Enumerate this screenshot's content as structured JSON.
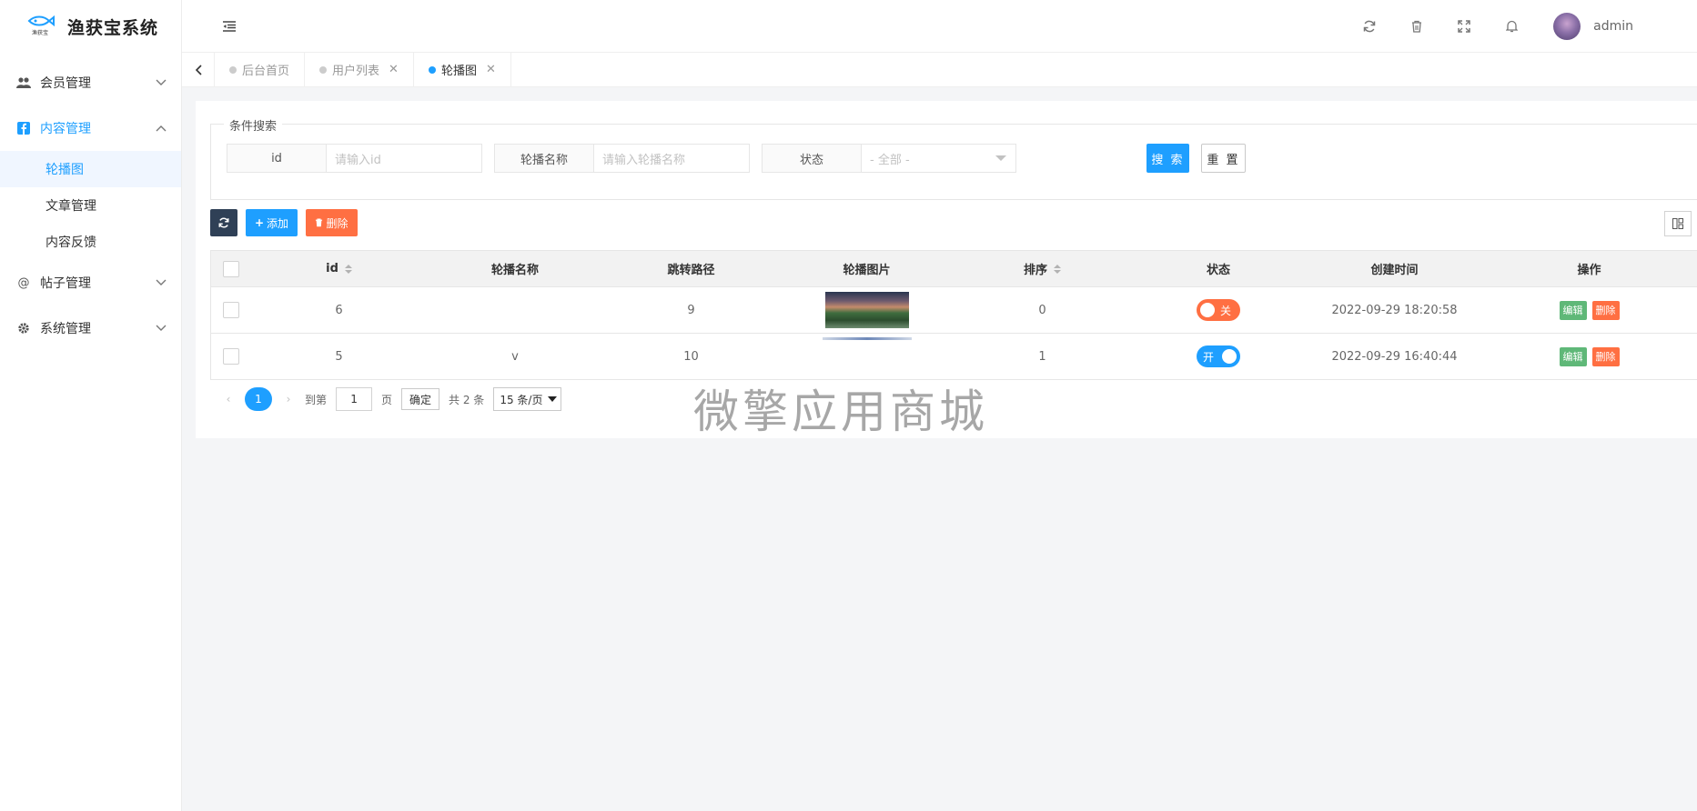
{
  "app": {
    "title": "渔获宝系统",
    "logo_text": "渔获宝"
  },
  "sidebar": {
    "items": [
      {
        "label": "会员管理",
        "icon": "users-icon",
        "expanded": false
      },
      {
        "label": "内容管理",
        "icon": "facebook-square-icon",
        "expanded": true,
        "children": [
          {
            "label": "轮播图",
            "active": true
          },
          {
            "label": "文章管理"
          },
          {
            "label": "内容反馈"
          }
        ]
      },
      {
        "label": "帖子管理",
        "icon": "at-icon",
        "expanded": false
      },
      {
        "label": "系统管理",
        "icon": "gear-icon",
        "expanded": false
      }
    ]
  },
  "header": {
    "icons": [
      "refresh-icon",
      "trash-icon",
      "fullscreen-icon",
      "bell-icon"
    ],
    "user_name": "admin"
  },
  "tabs": [
    {
      "label": "后台首页",
      "active": false,
      "closable": false
    },
    {
      "label": "用户列表",
      "active": false,
      "closable": true
    },
    {
      "label": "轮播图",
      "active": true,
      "closable": true
    }
  ],
  "search": {
    "legend": "条件搜索",
    "fields": [
      {
        "label": "id",
        "placeholder": "请输入id"
      },
      {
        "label": "轮播名称",
        "placeholder": "请输入轮播名称"
      },
      {
        "label": "状态",
        "selected": "- 全部 -"
      }
    ],
    "search_label": "搜 索",
    "reset_label": "重 置"
  },
  "toolbar": {
    "add_label": "添加",
    "delete_label": "删除"
  },
  "table": {
    "columns": [
      "id",
      "轮播名称",
      "跳转路径",
      "轮播图片",
      "排序",
      "状态",
      "创建时间",
      "操作"
    ],
    "rows": [
      {
        "id": "6",
        "name": "",
        "path": "9",
        "sort": "0",
        "status": "关",
        "status_on": false,
        "created": "2022-09-29 18:20:58",
        "edit": "编辑",
        "del": "删除"
      },
      {
        "id": "5",
        "name": "v",
        "path": "10",
        "sort": "1",
        "status": "开",
        "status_on": true,
        "created": "2022-09-29 16:40:44",
        "edit": "编辑",
        "del": "删除"
      }
    ]
  },
  "pager": {
    "current": "1",
    "goto_prefix": "到第",
    "goto_value": "1",
    "goto_suffix": "页",
    "confirm": "确定",
    "total": "共 2 条",
    "page_size": "15 条/页"
  },
  "watermark": "微擎应用商城",
  "colors": {
    "primary": "#1e9fff",
    "danger": "#ff5722",
    "success": "#5fb878",
    "dark": "#2f4056"
  }
}
